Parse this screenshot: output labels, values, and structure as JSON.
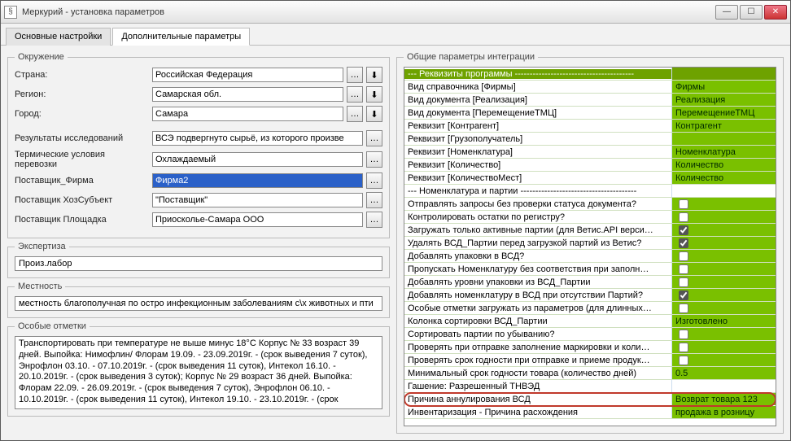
{
  "window": {
    "title": "Меркурий - установка параметров"
  },
  "tabs": {
    "main": "Основные настройки",
    "extra": "Дополнительные параметры"
  },
  "env": {
    "legend": "Окружение",
    "country_label": "Страна:",
    "country": "Российская Федерация",
    "region_label": "Регион:",
    "region": "Самарская обл.",
    "city_label": "Город:",
    "city": "Самара",
    "research_label": "Результаты исследований",
    "research": "ВСЭ подвергнуто сырьё, из которого произве",
    "thermal_label": "Термические условия перевозки",
    "thermal": "Охлаждаемый",
    "supplier_firm_label": "Поставщик_Фирма",
    "supplier_firm": "Фирма2",
    "supplier_hoz_label": "Поставщик ХозСубъект",
    "supplier_hoz": "\"Поставщик\"",
    "supplier_site_label": "Поставщик Площадка",
    "supplier_site": "Приосколье-Самара ООО"
  },
  "expertise": {
    "legend": "Экспертиза",
    "value": "Произ.лабор"
  },
  "area": {
    "legend": "Местность",
    "value": "местность благополучная по остро инфекционным заболеваниям с\\х животных и пти"
  },
  "notes": {
    "legend": "Особые отметки",
    "value": "Транспортировать при температуре не выше минус 18°С Корпус № 33 возраст 39 дней. Выпойка: Нимофлин/ Флорам 19.09. - 23.09.2019г. - (срок выведения 7 суток), Энрофлон 03.10. - 07.10.2019г. - (срок выведения 11 суток), Интекол 16.10. - 20.10.2019г. - (срок выведения 3 суток); Корпус № 29 возраст 36 дней. Выпойка: Флорам 22.09. - 26.09.2019г. - (срок выведения 7 суток), Энрофлон 06.10. - 10.10.2019г. - (срок выведения 11 суток), Интекол 19.10. - 23.10.2019г. - (срок"
  },
  "integration": {
    "legend": "Общие параметры интеграции",
    "rows": [
      {
        "type": "section",
        "name": "--- Реквизиты программы ----------------------------------------",
        "val": ""
      },
      {
        "type": "text",
        "name": "Вид справочника [Фирмы]",
        "val": "Фирмы"
      },
      {
        "type": "text",
        "name": "Вид документа [Реализация]",
        "val": "Реализация"
      },
      {
        "type": "text",
        "name": "Вид документа [ПеремещениеТМЦ]",
        "val": "ПеремещениеТМЦ"
      },
      {
        "type": "text",
        "name": "Реквизит [Контрагент]",
        "val": "Контрагент"
      },
      {
        "type": "text",
        "name": "Реквизит [Грузополучатель]",
        "val": ""
      },
      {
        "type": "text",
        "name": "Реквизит [Номенклатура]",
        "val": "Номенклатура"
      },
      {
        "type": "text",
        "name": "Реквизит [Количество]",
        "val": "Количество"
      },
      {
        "type": "text",
        "name": "Реквизит [КоличествоМест]",
        "val": "Количество"
      },
      {
        "type": "plain",
        "name": "--- Номенклатура и партии ---------------------------------------",
        "val": ""
      },
      {
        "type": "check",
        "name": "Отправлять запросы без проверки статуса документа?",
        "val": false
      },
      {
        "type": "check",
        "name": "Контролировать остатки по регистру?",
        "val": false
      },
      {
        "type": "check",
        "name": "Загружать только активные партии (для Ветис.API верси…",
        "val": true
      },
      {
        "type": "check",
        "name": "Удалять ВСД_Партии перед загрузкой партий из Ветис?",
        "val": true
      },
      {
        "type": "check",
        "name": "Добавлять упаковки в ВСД?",
        "val": false
      },
      {
        "type": "check",
        "name": "Пропускать Номенклатуру без соответствия при заполн…",
        "val": false
      },
      {
        "type": "check",
        "name": "Добавлять уровни упаковки из ВСД_Партии",
        "val": false
      },
      {
        "type": "check",
        "name": "Добавлять номенклатуру в ВСД при отсутствии Партий?",
        "val": true
      },
      {
        "type": "check",
        "name": "Особые отметки загружать из параметров (для длинных…",
        "val": false
      },
      {
        "type": "text",
        "name": "Колонка сортировки ВСД_Партии",
        "val": "Изготовлено"
      },
      {
        "type": "check",
        "name": "Сортировать партии по убыванию?",
        "val": false
      },
      {
        "type": "check",
        "name": "Проверять при отправке заполнение маркировки и коли…",
        "val": false
      },
      {
        "type": "check",
        "name": "Проверять срок годности при отправке и приеме продук…",
        "val": false
      },
      {
        "type": "text",
        "name": "Минимальный срок годности товара (количество дней)",
        "val": "0.5"
      },
      {
        "type": "plain",
        "name": "Гашение: Разрешенный ТНВЭД",
        "val": ""
      },
      {
        "type": "text",
        "name": "Причина аннулирования ВСД",
        "val": "Возврат товара 123",
        "hl": true
      },
      {
        "type": "text",
        "name": "Инвентаризация - Причина расхождения",
        "val": "продажа в розницу"
      }
    ]
  }
}
